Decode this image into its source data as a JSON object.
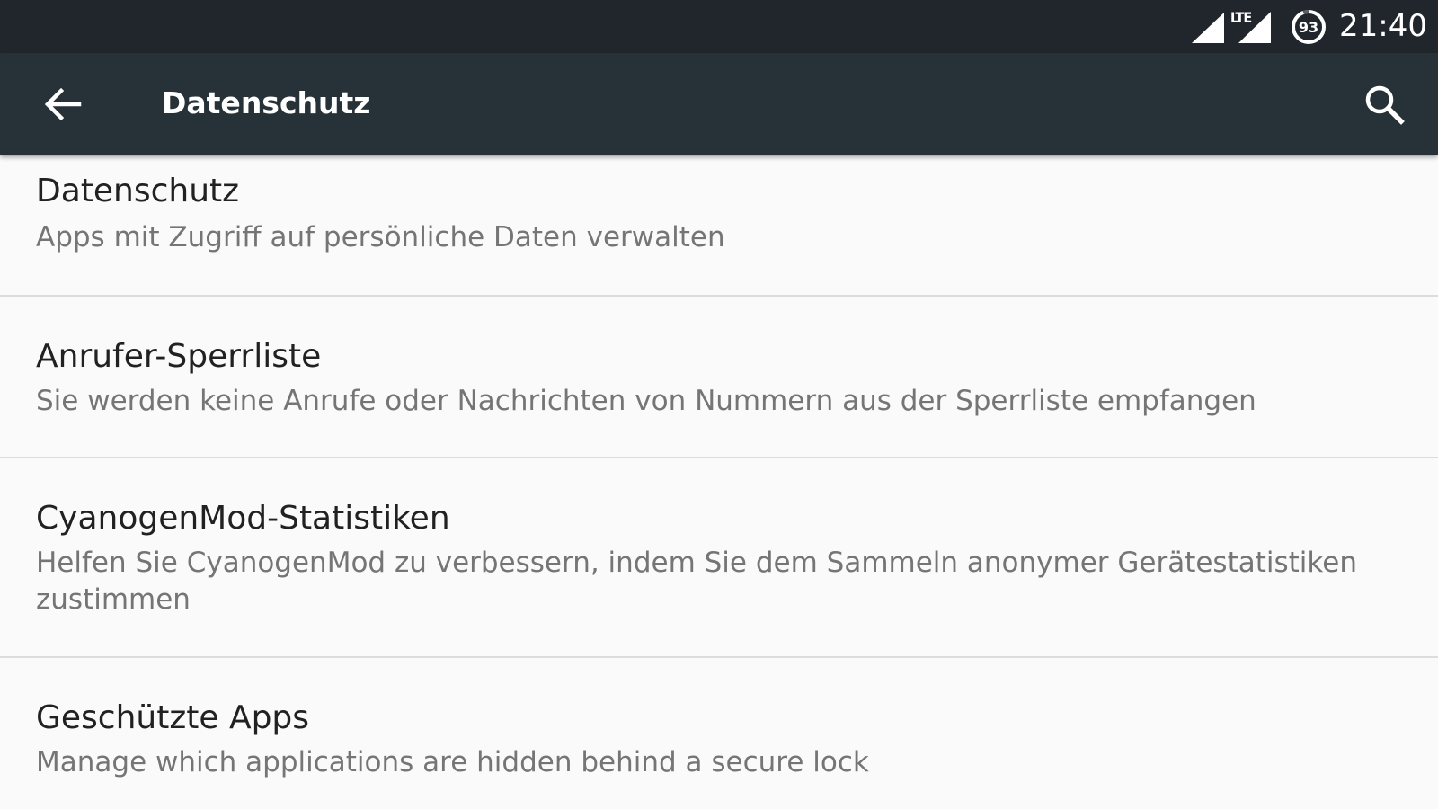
{
  "status_bar": {
    "network_label": "LTE",
    "battery_level": "93",
    "time": "21:40",
    "icons": [
      "signal-icon",
      "lte-signal-icon",
      "battery-icon"
    ]
  },
  "toolbar": {
    "back_icon": "arrow-back-icon",
    "title": "Datenschutz",
    "search_icon": "search-icon",
    "background_color": "#263238"
  },
  "items": [
    {
      "title": "Datenschutz",
      "summary": "Apps mit Zugriff auf persönliche Daten verwalten"
    },
    {
      "title": "Anrufer-Sperrliste",
      "summary": "Sie werden keine Anrufe oder Nachrichten von Nummern aus der Sperrliste empfangen"
    },
    {
      "title": "CyanogenMod-Statistiken",
      "summary": "Helfen Sie CyanogenMod zu verbessern, indem Sie dem Sammeln anonymer Gerätestatistiken zustimmen"
    },
    {
      "title": "Geschützte Apps",
      "summary": "Manage which applications are hidden behind a secure lock"
    }
  ]
}
